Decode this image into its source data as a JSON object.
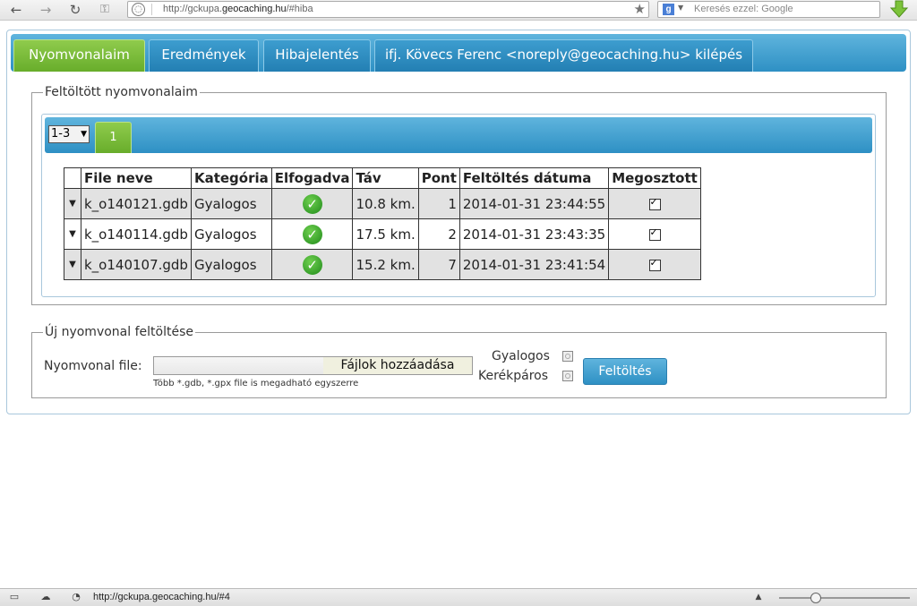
{
  "browser": {
    "url_prefix": "http://gckupa.",
    "url_domain": "geocaching.hu",
    "url_suffix": "/#hiba",
    "search_placeholder": "Keresés ezzel: Google",
    "search_engine_letter": "g",
    "icons": [
      "back-icon",
      "forward-icon",
      "reload-icon",
      "key-icon",
      "globe-icon",
      "star-icon",
      "download-icon"
    ]
  },
  "tabs": [
    {
      "label": "Nyomvonalaim",
      "active": true
    },
    {
      "label": "Eredmények",
      "active": false
    },
    {
      "label": "Hibajelentés",
      "active": false
    },
    {
      "label": "ifj. Kövecs Ferenc <noreply@geocaching.hu> kilépés",
      "active": false
    }
  ],
  "uploaded": {
    "legend": "Feltöltött nyomvonalaim",
    "range_select": "1-3",
    "page": "1",
    "columns": [
      "File neve",
      "Kategória",
      "Elfogadva",
      "Táv",
      "Pont",
      "Feltöltés dátuma",
      "Megosztott"
    ],
    "rows": [
      {
        "file": "k_o140121.gdb",
        "category": "Gyalogos",
        "accepted": true,
        "distance": "10.8 km.",
        "points": "1",
        "date": "2014-01-31 23:44:55",
        "shared": true
      },
      {
        "file": "k_o140114.gdb",
        "category": "Gyalogos",
        "accepted": true,
        "distance": "17.5 km.",
        "points": "2",
        "date": "2014-01-31 23:43:35",
        "shared": true
      },
      {
        "file": "k_o140107.gdb",
        "category": "Gyalogos",
        "accepted": true,
        "distance": "15.2 km.",
        "points": "7",
        "date": "2014-01-31 23:41:54",
        "shared": true
      }
    ]
  },
  "new_upload": {
    "legend": "Új nyomvonal feltöltése",
    "file_label": "Nyomvonal file:",
    "add_files_button": "Fájlok hozzáadása",
    "hint": "Több *.gdb, *.gpx file is megadható egyszerre",
    "option_walk": "Gyalogos",
    "option_bike": "Kerékpáros",
    "upload_button": "Feltöltés"
  },
  "statusbar": {
    "url": "http://gckupa.geocaching.hu/#4"
  }
}
